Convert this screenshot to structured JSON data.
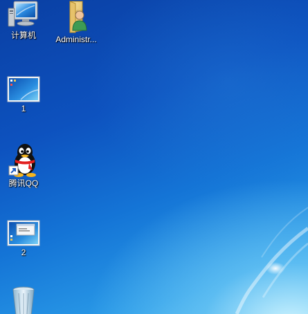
{
  "desktop": {
    "icons": [
      {
        "label": "计算机",
        "icon": "computer-icon"
      },
      {
        "label": "Administr...",
        "icon": "user-folder-icon"
      },
      {
        "label": "1",
        "icon": "screenshot-thumbnail-icon"
      },
      {
        "label": "腾讯QQ",
        "icon": "qq-penguin-shortcut-icon"
      },
      {
        "label": "2",
        "icon": "screenshot-thumbnail-icon"
      },
      {
        "label": "",
        "icon": "recycle-bin-icon"
      }
    ]
  },
  "colors": {
    "wallpaper_dark": "#0a3fa3",
    "wallpaper_mid": "#1474d6",
    "wallpaper_light": "#56c0f2",
    "label_text": "#ffffff"
  }
}
